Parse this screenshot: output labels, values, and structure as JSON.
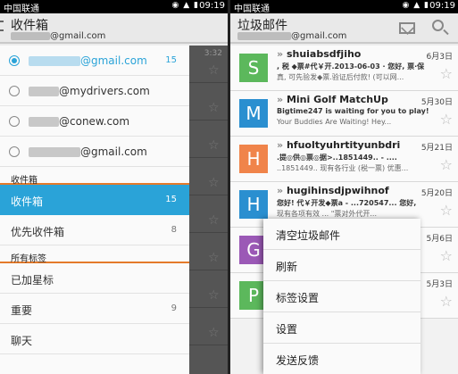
{
  "left": {
    "status": {
      "carrier": "中国联通",
      "icons": "◉ ▲ ▮",
      "time": "09:19"
    },
    "header": {
      "title": "收件箱",
      "account_suffix": "@gmail.com"
    },
    "accounts": [
      {
        "suffix": "@gmail.com",
        "count": "15",
        "selected": true
      },
      {
        "suffix": "@mydrivers.com",
        "count": ""
      },
      {
        "suffix": "@conew.com",
        "count": ""
      },
      {
        "suffix": "@gmail.com",
        "count": ""
      }
    ],
    "section_inbox": "收件箱",
    "inbox_items": [
      {
        "label": "收件箱",
        "count": "15"
      },
      {
        "label": "优先收件箱",
        "count": "8"
      }
    ],
    "section_labels": "所有标签",
    "label_items": [
      {
        "label": "已加星标",
        "count": ""
      },
      {
        "label": "重要",
        "count": "9"
      },
      {
        "label": "聊天",
        "count": ""
      }
    ],
    "behind_dates": [
      "3:32",
      "",
      "",
      "",
      "",
      "",
      "",
      ""
    ]
  },
  "right": {
    "status": {
      "carrier": "中国联通",
      "icons": "◉ ▲ ▮",
      "time": "09:19"
    },
    "header": {
      "title": "垃圾邮件",
      "account_suffix": "@gmail.com"
    },
    "icons": {
      "compose": "compose-icon",
      "search": "search-icon"
    },
    "mails": [
      {
        "letter": "S",
        "color": "#5cb85c",
        "sender": "shuiabsdfjiho",
        "subject": ", 税 ◆票#代￥开.2013-06-03 · 您好, 票·保",
        "snippet": "真, 可先验发◆票.验证后付款! (可以网...",
        "date": "6月3日"
      },
      {
        "letter": "M",
        "color": "#2a8fd0",
        "sender": "Mini Golf MatchUp",
        "subject": "Bigtime247 is waiting for you to play! -",
        "snippet": "Your Buddies Are Waiting! Hey...",
        "date": "5月30日"
      },
      {
        "letter": "H",
        "color": "#f0844a",
        "sender": "hfuoltyuhrtityunbdri",
        "subject": ".提◎供◎票◎据>..1851449.. - ....",
        "snippet": "..1851449.. 现有各行业 (税一票) 优惠...",
        "date": "5月21日"
      },
      {
        "letter": "H",
        "color": "#2a8fd0",
        "sender": "hugihinsdjpwihnof",
        "subject": "您好! 代￥开发◆票a - ...720547... 您好,",
        "snippet": "现有各项有效 ... \"票对外代开...",
        "date": "5月20日"
      },
      {
        "letter": "G",
        "color": "#9b59b6",
        "sender": "",
        "subject": "",
        "snippet": "",
        "date": "5月6日"
      },
      {
        "letter": "P",
        "color": "#5cb85c",
        "sender": "",
        "subject": "",
        "snippet": "",
        "date": "5月3日"
      }
    ],
    "menu": [
      "清空垃圾邮件",
      "刷新",
      "标签设置",
      "设置",
      "发送反馈"
    ]
  }
}
